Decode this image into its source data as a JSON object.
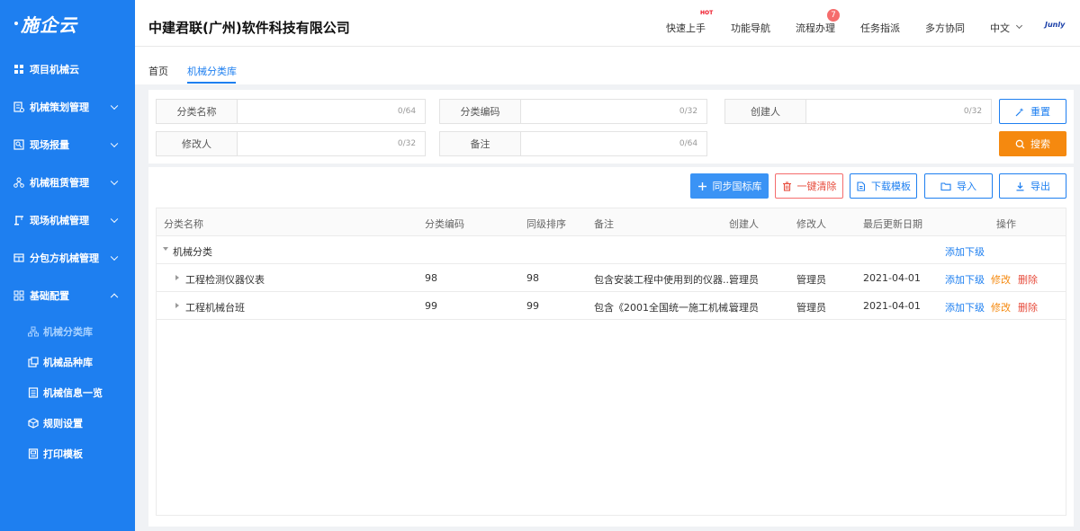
{
  "sidebar": {
    "logo": "施企云",
    "items": [
      {
        "label": "项目机械云"
      },
      {
        "label": "机械策划管理"
      },
      {
        "label": "现场报量"
      },
      {
        "label": "机械租赁管理"
      },
      {
        "label": "现场机械管理"
      },
      {
        "label": "分包方机械管理"
      },
      {
        "label": "基础配置"
      }
    ],
    "subitems": [
      {
        "label": "机械分类库"
      },
      {
        "label": "机械品种库"
      },
      {
        "label": "机械信息一览"
      },
      {
        "label": "规则设置"
      },
      {
        "label": "打印模板"
      }
    ]
  },
  "header": {
    "company": "中建君联(广州)软件科技有限公司",
    "nav": [
      "快速上手",
      "功能导航",
      "流程办理",
      "任务指派",
      "多方协同",
      "中文"
    ],
    "hot": "HOT",
    "badge": "7",
    "brand": "Junly"
  },
  "tabs": [
    "首页",
    "机械分类库"
  ],
  "search": {
    "fields": [
      {
        "label": "分类名称",
        "count": "0/64"
      },
      {
        "label": "分类编码",
        "count": "0/32"
      },
      {
        "label": "创建人",
        "count": "0/32"
      },
      {
        "label": "修改人",
        "count": "0/32"
      },
      {
        "label": "备注",
        "count": "0/64"
      }
    ],
    "reset": "重置",
    "search": "搜索"
  },
  "toolbar": {
    "sync": "同步国标库",
    "clear": "一键清除",
    "download": "下载模板",
    "import": "导入",
    "export": "导出"
  },
  "table": {
    "headers": [
      "分类名称",
      "分类编码",
      "同级排序",
      "备注",
      "创建人",
      "修改人",
      "最后更新日期",
      "操作"
    ],
    "group": {
      "name": "机械分类",
      "action": "添加下级"
    },
    "rows": [
      {
        "name": "工程检测仪器仪表",
        "code": "98",
        "sort": "98",
        "note": "包含安装工程中使用到的仪器...",
        "creator": "管理员",
        "modifier": "管理员",
        "date": "2021-04-01"
      },
      {
        "name": "工程机械台班",
        "code": "99",
        "sort": "99",
        "note": "包含《2001全国统一施工机械...",
        "creator": "管理员",
        "modifier": "管理员",
        "date": "2021-04-01"
      }
    ],
    "actions": {
      "add": "添加下级",
      "edit": "修改",
      "del": "删除"
    }
  },
  "colors": {
    "sidebar": "#1e7ff0",
    "accent": "#1e7ff0",
    "search_btn": "#f5890f",
    "danger": "#e74c3c"
  }
}
